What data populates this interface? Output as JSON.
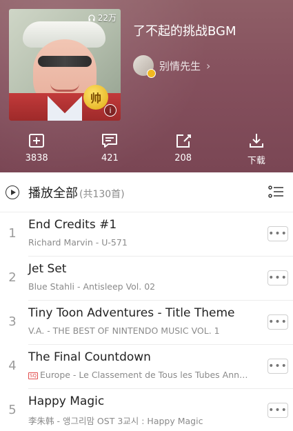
{
  "playlist": {
    "title": "了不起的挑战BGM",
    "play_count": "22万",
    "creator": "别情先生",
    "cover_badge": "帅",
    "info_icon": "info-icon"
  },
  "actions": [
    {
      "label": "3838",
      "icon": "collect-icon"
    },
    {
      "label": "421",
      "icon": "comment-icon"
    },
    {
      "label": "208",
      "icon": "share-icon"
    },
    {
      "label": "下载",
      "icon": "download-icon"
    }
  ],
  "list": {
    "play_all_label": "播放全部",
    "count_label": "(共130首)",
    "mode_icon": "list-mode-icon"
  },
  "songs": [
    {
      "index": "1",
      "title": "End Credits #1",
      "meta": "Richard Marvin - U-571"
    },
    {
      "index": "2",
      "title": "Jet Set",
      "meta": "Blue Stahli - Antisleep Vol. 02"
    },
    {
      "index": "3",
      "title": "Tiny Toon Adventures - Title Theme",
      "meta": "V.A. - THE BEST OF NINTENDO MUSIC VOL. 1"
    },
    {
      "index": "4",
      "title": "The Final Countdown",
      "meta": "Europe - Le Classement de Tous les Tubes Ann…",
      "sq_badge": "SQ"
    },
    {
      "index": "5",
      "title": "Happy Magic",
      "meta": "李朱韩 - 앵그리맘 OST 3교시 : Happy Magic"
    }
  ],
  "colors": {
    "header_bg": "#85505d",
    "accent_badge": "#f2b820"
  }
}
